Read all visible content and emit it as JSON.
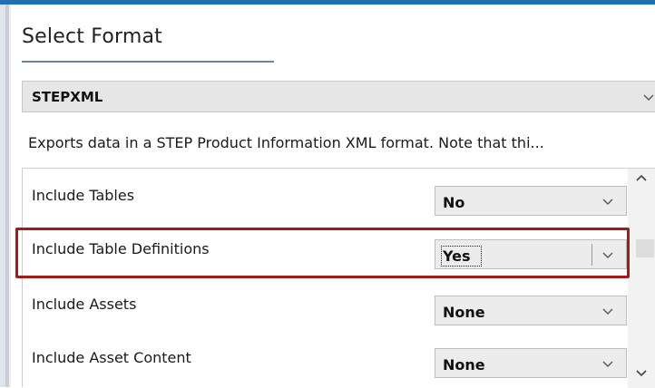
{
  "panel": {
    "title": "Select Format",
    "format_select": {
      "value": "STEPXML",
      "icon": "chevron-down-icon"
    },
    "description": "Exports data in a STEP Product Information XML format. Note that thi..."
  },
  "properties": [
    {
      "label": "Include Tables",
      "value": "No"
    },
    {
      "label": "Include Table Definitions",
      "value": "Yes",
      "focused": true,
      "highlighted": true
    },
    {
      "label": "Include Assets",
      "value": "None"
    },
    {
      "label": "Include Asset Content",
      "value": "None"
    }
  ],
  "scrollbar": {
    "up_icon": "chevron-up-icon",
    "down_icon": "chevron-down-icon"
  },
  "colors": {
    "accent": "#1f6fb7",
    "highlight_border": "#a01c1c",
    "select_bg": "#e6e6e6"
  }
}
